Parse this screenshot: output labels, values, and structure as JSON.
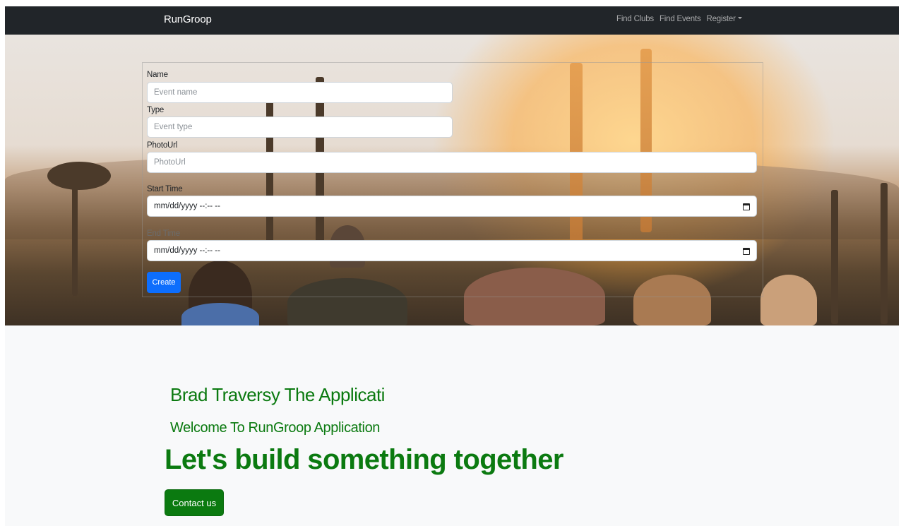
{
  "navbar": {
    "brand": "RunGroop",
    "links": [
      "Find Clubs",
      "Find Events"
    ],
    "dropdown_label": "Register"
  },
  "form": {
    "name_label": "Name",
    "name_placeholder": "Event name",
    "type_label": "Type",
    "type_placeholder": "Event type",
    "photo_label": "PhotoUrl",
    "photo_placeholder": "PhotoUrl",
    "start_label": "Start Time",
    "start_value": "mm/dd/yyyy --:-- --",
    "end_label": "End Time",
    "end_value": "mm/dd/yyyy --:-- --",
    "submit_label": "Create"
  },
  "section": {
    "title": "Brad Traversy The Applicati",
    "welcome": "Welcome To RunGroop Application",
    "tagline": "Let's build something together",
    "contact_label": "Contact us"
  },
  "colors": {
    "navbar": "#212529",
    "primary": "#0d6efd",
    "accent_green": "#0b7a10"
  },
  "icons": [
    "calendar-icon",
    "caret-down-icon"
  ]
}
